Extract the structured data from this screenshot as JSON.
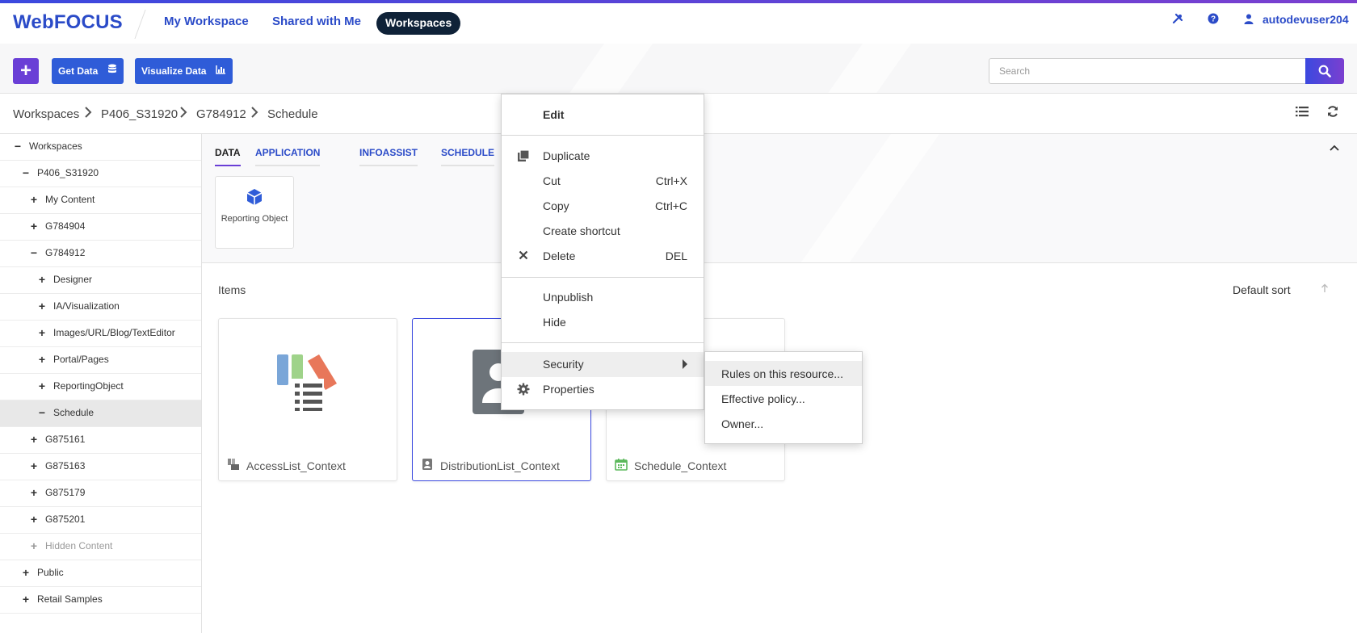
{
  "app": {
    "brand": "WebFOCUS"
  },
  "nav": {
    "my_workspace": "My Workspace",
    "shared_with_me": "Shared with Me",
    "workspaces": "Workspaces"
  },
  "header": {
    "username": "autodevuser204",
    "tools_icon": "tools-icon",
    "help_icon": "help-icon",
    "user_icon": "user-icon"
  },
  "toolbar": {
    "add_label": "+",
    "get_data_label": "Get Data",
    "visualize_data_label": "Visualize Data",
    "search_placeholder": "Search",
    "search_value": ""
  },
  "breadcrumb": [
    "Workspaces",
    "P406_S31920",
    "G784912",
    "Schedule"
  ],
  "tree": [
    {
      "toggle": "−",
      "label": "Workspaces",
      "level": 0
    },
    {
      "toggle": "−",
      "label": "P406_S31920",
      "level": 1
    },
    {
      "toggle": "+",
      "label": "My Content",
      "level": 2
    },
    {
      "toggle": "+",
      "label": "G784904",
      "level": 2
    },
    {
      "toggle": "−",
      "label": "G784912",
      "level": 2
    },
    {
      "toggle": "+",
      "label": "Designer",
      "level": 3
    },
    {
      "toggle": "+",
      "label": "IA/Visualization",
      "level": 3
    },
    {
      "toggle": "+",
      "label": "Images/URL/Blog/TextEditor",
      "level": 3
    },
    {
      "toggle": "+",
      "label": "Portal/Pages",
      "level": 3
    },
    {
      "toggle": "+",
      "label": "ReportingObject",
      "level": 3
    },
    {
      "toggle": "−",
      "label": "Schedule",
      "level": 3,
      "selected": true
    },
    {
      "toggle": "+",
      "label": "G875161",
      "level": 2
    },
    {
      "toggle": "+",
      "label": "G875163",
      "level": 2
    },
    {
      "toggle": "+",
      "label": "G875179",
      "level": 2
    },
    {
      "toggle": "+",
      "label": "G875201",
      "level": 2
    },
    {
      "toggle": "+",
      "label": "Hidden Content",
      "level": 2,
      "muted": true
    },
    {
      "toggle": "+",
      "label": "Public",
      "level": 1
    },
    {
      "toggle": "+",
      "label": "Retail Samples",
      "level": 1
    }
  ],
  "tabs": [
    "DATA",
    "APPLICATION",
    "INFOASSIST",
    "SCHEDULE"
  ],
  "tool_tile": {
    "label": "Reporting Object"
  },
  "items": {
    "label": "Items",
    "sort_label": "Default sort",
    "cards": [
      "AccessList_Context",
      "DistributionList_Context",
      "Schedule_Context"
    ]
  },
  "context_menu": {
    "edit": "Edit",
    "duplicate": "Duplicate",
    "cut": "Cut",
    "cut_shortcut": "Ctrl+X",
    "copy": "Copy",
    "copy_shortcut": "Ctrl+C",
    "create_shortcut": "Create shortcut",
    "delete": "Delete",
    "delete_shortcut": "DEL",
    "unpublish": "Unpublish",
    "hide": "Hide",
    "security": "Security",
    "properties": "Properties"
  },
  "security_submenu": {
    "rules": "Rules on this resource...",
    "effective_policy": "Effective policy...",
    "owner": "Owner..."
  },
  "colors": {
    "brand_blue": "#2b4bc8",
    "accent_purple": "#6a3fd6",
    "nav_active_bg": "#0f2238"
  }
}
